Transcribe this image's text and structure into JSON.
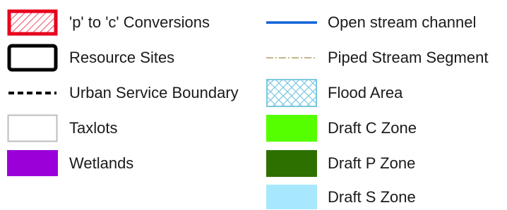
{
  "legend": {
    "items": [
      {
        "label": "'p' to 'c' Conversions",
        "icon": "hatched-red-box-icon",
        "colors": {
          "border": "#e8001c",
          "hatch": "#e8001c"
        }
      },
      {
        "label": "Resource Sites",
        "icon": "black-outline-box-icon",
        "colors": {
          "border": "#000000"
        }
      },
      {
        "label": "Urban Service Boundary",
        "icon": "dashed-line-icon",
        "colors": {
          "line": "#000000"
        }
      },
      {
        "label": "Taxlots",
        "icon": "gray-outline-box-icon",
        "colors": {
          "border": "#bdbdbd"
        }
      },
      {
        "label": "Wetlands",
        "icon": "purple-fill-box-icon",
        "colors": {
          "fill": "#9b00d9"
        }
      },
      {
        "label": "Open stream channel",
        "icon": "blue-line-icon",
        "colors": {
          "line": "#1060d8"
        }
      },
      {
        "label": "Piped Stream Segment",
        "icon": "dash-dot-line-icon",
        "colors": {
          "line": "#c9b48a"
        }
      },
      {
        "label": "Flood Area",
        "icon": "crosshatch-box-icon",
        "colors": {
          "border": "#7cc8e0",
          "fill": "#dff3fa"
        }
      },
      {
        "label": "Draft C Zone",
        "icon": "green-fill-box-icon",
        "colors": {
          "fill": "#55ff00"
        }
      },
      {
        "label": "Draft P Zone",
        "icon": "dark-green-fill-box-icon",
        "colors": {
          "fill": "#2d7000"
        }
      },
      {
        "label": "Draft S Zone",
        "icon": "light-blue-fill-box-icon",
        "colors": {
          "fill": "#a8e8ff"
        }
      }
    ]
  }
}
